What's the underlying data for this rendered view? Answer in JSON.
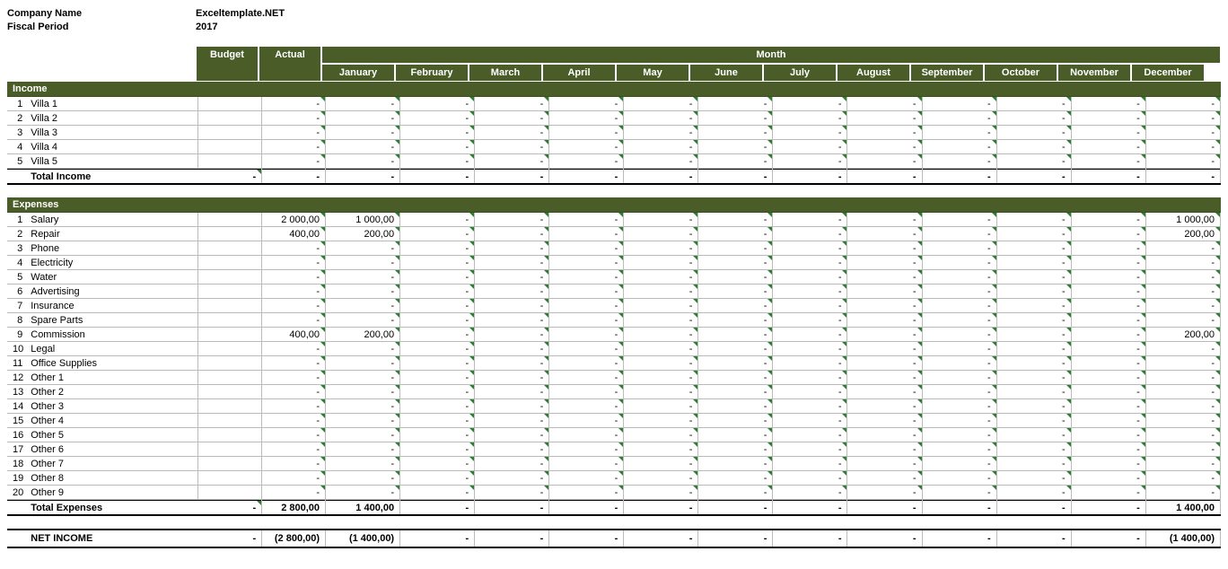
{
  "header": {
    "company_label": "Company Name",
    "company_value": "Exceltemplate.NET",
    "period_label": "Fiscal Period",
    "period_value": "2017"
  },
  "columns": {
    "budget": "Budget",
    "actual": "Actual",
    "month_group": "Month",
    "months": [
      "January",
      "February",
      "March",
      "April",
      "May",
      "June",
      "July",
      "August",
      "September",
      "October",
      "November",
      "December"
    ]
  },
  "income": {
    "title": "Income",
    "rows": [
      {
        "n": "1",
        "name": "Villa 1",
        "actual": "-",
        "months": [
          "-",
          "-",
          "-",
          "-",
          "-",
          "-",
          "-",
          "-",
          "-",
          "-",
          "-",
          "-"
        ]
      },
      {
        "n": "2",
        "name": "Villa 2",
        "actual": "-",
        "months": [
          "-",
          "-",
          "-",
          "-",
          "-",
          "-",
          "-",
          "-",
          "-",
          "-",
          "-",
          "-"
        ]
      },
      {
        "n": "3",
        "name": "Villa 3",
        "actual": "-",
        "months": [
          "-",
          "-",
          "-",
          "-",
          "-",
          "-",
          "-",
          "-",
          "-",
          "-",
          "-",
          "-"
        ]
      },
      {
        "n": "4",
        "name": "Villa 4",
        "actual": "-",
        "months": [
          "-",
          "-",
          "-",
          "-",
          "-",
          "-",
          "-",
          "-",
          "-",
          "-",
          "-",
          "-"
        ]
      },
      {
        "n": "5",
        "name": "Villa 5",
        "actual": "-",
        "months": [
          "-",
          "-",
          "-",
          "-",
          "-",
          "-",
          "-",
          "-",
          "-",
          "-",
          "-",
          "-"
        ]
      }
    ],
    "total_label": "Total Income",
    "total": {
      "budget": "-",
      "actual": "-",
      "months": [
        "-",
        "-",
        "-",
        "-",
        "-",
        "-",
        "-",
        "-",
        "-",
        "-",
        "-",
        "-"
      ]
    }
  },
  "expenses": {
    "title": "Expenses",
    "rows": [
      {
        "n": "1",
        "name": "Salary",
        "actual": "2 000,00",
        "months": [
          "1 000,00",
          "-",
          "-",
          "-",
          "-",
          "-",
          "-",
          "-",
          "-",
          "-",
          "-",
          "1 000,00"
        ]
      },
      {
        "n": "2",
        "name": "Repair",
        "actual": "400,00",
        "months": [
          "200,00",
          "-",
          "-",
          "-",
          "-",
          "-",
          "-",
          "-",
          "-",
          "-",
          "-",
          "200,00"
        ]
      },
      {
        "n": "3",
        "name": "Phone",
        "actual": "-",
        "months": [
          "-",
          "-",
          "-",
          "-",
          "-",
          "-",
          "-",
          "-",
          "-",
          "-",
          "-",
          "-"
        ]
      },
      {
        "n": "4",
        "name": "Electricity",
        "actual": "-",
        "months": [
          "-",
          "-",
          "-",
          "-",
          "-",
          "-",
          "-",
          "-",
          "-",
          "-",
          "-",
          "-"
        ]
      },
      {
        "n": "5",
        "name": "Water",
        "actual": "-",
        "months": [
          "-",
          "-",
          "-",
          "-",
          "-",
          "-",
          "-",
          "-",
          "-",
          "-",
          "-",
          "-"
        ]
      },
      {
        "n": "6",
        "name": "Advertising",
        "actual": "-",
        "months": [
          "-",
          "-",
          "-",
          "-",
          "-",
          "-",
          "-",
          "-",
          "-",
          "-",
          "-",
          "-"
        ]
      },
      {
        "n": "7",
        "name": "Insurance",
        "actual": "-",
        "months": [
          "-",
          "-",
          "-",
          "-",
          "-",
          "-",
          "-",
          "-",
          "-",
          "-",
          "-",
          "-"
        ]
      },
      {
        "n": "8",
        "name": "Spare Parts",
        "actual": "-",
        "months": [
          "-",
          "-",
          "-",
          "-",
          "-",
          "-",
          "-",
          "-",
          "-",
          "-",
          "-",
          "-"
        ]
      },
      {
        "n": "9",
        "name": "Commission",
        "actual": "400,00",
        "months": [
          "200,00",
          "-",
          "-",
          "-",
          "-",
          "-",
          "-",
          "-",
          "-",
          "-",
          "-",
          "200,00"
        ]
      },
      {
        "n": "10",
        "name": "Legal",
        "actual": "-",
        "months": [
          "-",
          "-",
          "-",
          "-",
          "-",
          "-",
          "-",
          "-",
          "-",
          "-",
          "-",
          "-"
        ]
      },
      {
        "n": "11",
        "name": "Office Supplies",
        "actual": "-",
        "months": [
          "-",
          "-",
          "-",
          "-",
          "-",
          "-",
          "-",
          "-",
          "-",
          "-",
          "-",
          "-"
        ]
      },
      {
        "n": "12",
        "name": "Other 1",
        "actual": "-",
        "months": [
          "-",
          "-",
          "-",
          "-",
          "-",
          "-",
          "-",
          "-",
          "-",
          "-",
          "-",
          "-"
        ]
      },
      {
        "n": "13",
        "name": "Other 2",
        "actual": "-",
        "months": [
          "-",
          "-",
          "-",
          "-",
          "-",
          "-",
          "-",
          "-",
          "-",
          "-",
          "-",
          "-"
        ]
      },
      {
        "n": "14",
        "name": "Other 3",
        "actual": "-",
        "months": [
          "-",
          "-",
          "-",
          "-",
          "-",
          "-",
          "-",
          "-",
          "-",
          "-",
          "-",
          "-"
        ]
      },
      {
        "n": "15",
        "name": "Other 4",
        "actual": "-",
        "months": [
          "-",
          "-",
          "-",
          "-",
          "-",
          "-",
          "-",
          "-",
          "-",
          "-",
          "-",
          "-"
        ]
      },
      {
        "n": "16",
        "name": "Other 5",
        "actual": "-",
        "months": [
          "-",
          "-",
          "-",
          "-",
          "-",
          "-",
          "-",
          "-",
          "-",
          "-",
          "-",
          "-"
        ]
      },
      {
        "n": "17",
        "name": "Other 6",
        "actual": "-",
        "months": [
          "-",
          "-",
          "-",
          "-",
          "-",
          "-",
          "-",
          "-",
          "-",
          "-",
          "-",
          "-"
        ]
      },
      {
        "n": "18",
        "name": "Other 7",
        "actual": "-",
        "months": [
          "-",
          "-",
          "-",
          "-",
          "-",
          "-",
          "-",
          "-",
          "-",
          "-",
          "-",
          "-"
        ]
      },
      {
        "n": "19",
        "name": "Other 8",
        "actual": "-",
        "months": [
          "-",
          "-",
          "-",
          "-",
          "-",
          "-",
          "-",
          "-",
          "-",
          "-",
          "-",
          "-"
        ]
      },
      {
        "n": "20",
        "name": "Other 9",
        "actual": "-",
        "months": [
          "-",
          "-",
          "-",
          "-",
          "-",
          "-",
          "-",
          "-",
          "-",
          "-",
          "-",
          "-"
        ]
      }
    ],
    "total_label": "Total Expenses",
    "total": {
      "budget": "-",
      "actual": "2 800,00",
      "months": [
        "1 400,00",
        "-",
        "-",
        "-",
        "-",
        "-",
        "-",
        "-",
        "-",
        "-",
        "-",
        "1 400,00"
      ]
    }
  },
  "net": {
    "label": "NET INCOME",
    "budget": "-",
    "actual": "(2 800,00)",
    "months": [
      "(1 400,00)",
      "-",
      "-",
      "-",
      "-",
      "-",
      "-",
      "-",
      "-",
      "-",
      "-",
      "(1 400,00)"
    ]
  }
}
